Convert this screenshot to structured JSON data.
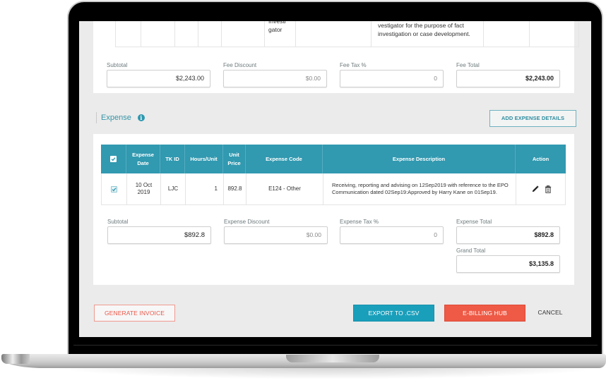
{
  "fee_section": {
    "table_fragment": {
      "role_cell_lines": [
        "Investi",
        "gator"
      ],
      "description_lines": [
        "vestigator for the purpose of fact",
        "investigation or case development."
      ]
    },
    "fields": [
      {
        "label": "Subtotal",
        "value": "$2,243.00"
      },
      {
        "label": "Fee Discount",
        "value": "$0.00"
      },
      {
        "label": "Fee Tax %",
        "value": "0"
      },
      {
        "label": "Fee Total",
        "value": "$2,243.00"
      }
    ]
  },
  "expense_section": {
    "title": "Expense",
    "info_icon_glyph": "i",
    "add_button": "ADD EXPENSE DETAILS",
    "table": {
      "headers": [
        "",
        "Expense Date",
        "TK ID",
        "Hours/Unit",
        "Unit Price",
        "Expense Code",
        "Expense Description",
        "Action"
      ],
      "rows": [
        {
          "checked": true,
          "date": "10 Oct 2019",
          "tk_id": "LJC",
          "hours": "1",
          "unit_price": "892.8",
          "code": "E124 - Other",
          "description": "Receiving, reporting and advising on 12Sep2019 with reference to the EPO Communication dated 02Sep19:Approved by Harry Kane on 01Sep19.",
          "actions": [
            "edit-icon",
            "delete-icon"
          ]
        }
      ]
    },
    "fields": [
      {
        "label": "Subtotal",
        "value": "$892.8"
      },
      {
        "label": "Expense Discount",
        "value": "$0.00"
      },
      {
        "label": "Expense Tax %",
        "value": "0"
      },
      {
        "label": "Expense Total",
        "value": "$892.8"
      }
    ],
    "grand_total": {
      "label": "Grand Total",
      "value": "$3,135.8"
    }
  },
  "footer": {
    "generate_invoice": "GENERATE INVOICE",
    "export_csv": "EXPORT TO .CSV",
    "ebilling_hub": "E-BILLING HUB",
    "cancel": "CANCEL"
  },
  "colors": {
    "accent_teal": "#3199b0",
    "export_button": "#1a9fbb",
    "ebilling_button": "#ee5a45",
    "generate_invoice_text": "#e9584a"
  }
}
